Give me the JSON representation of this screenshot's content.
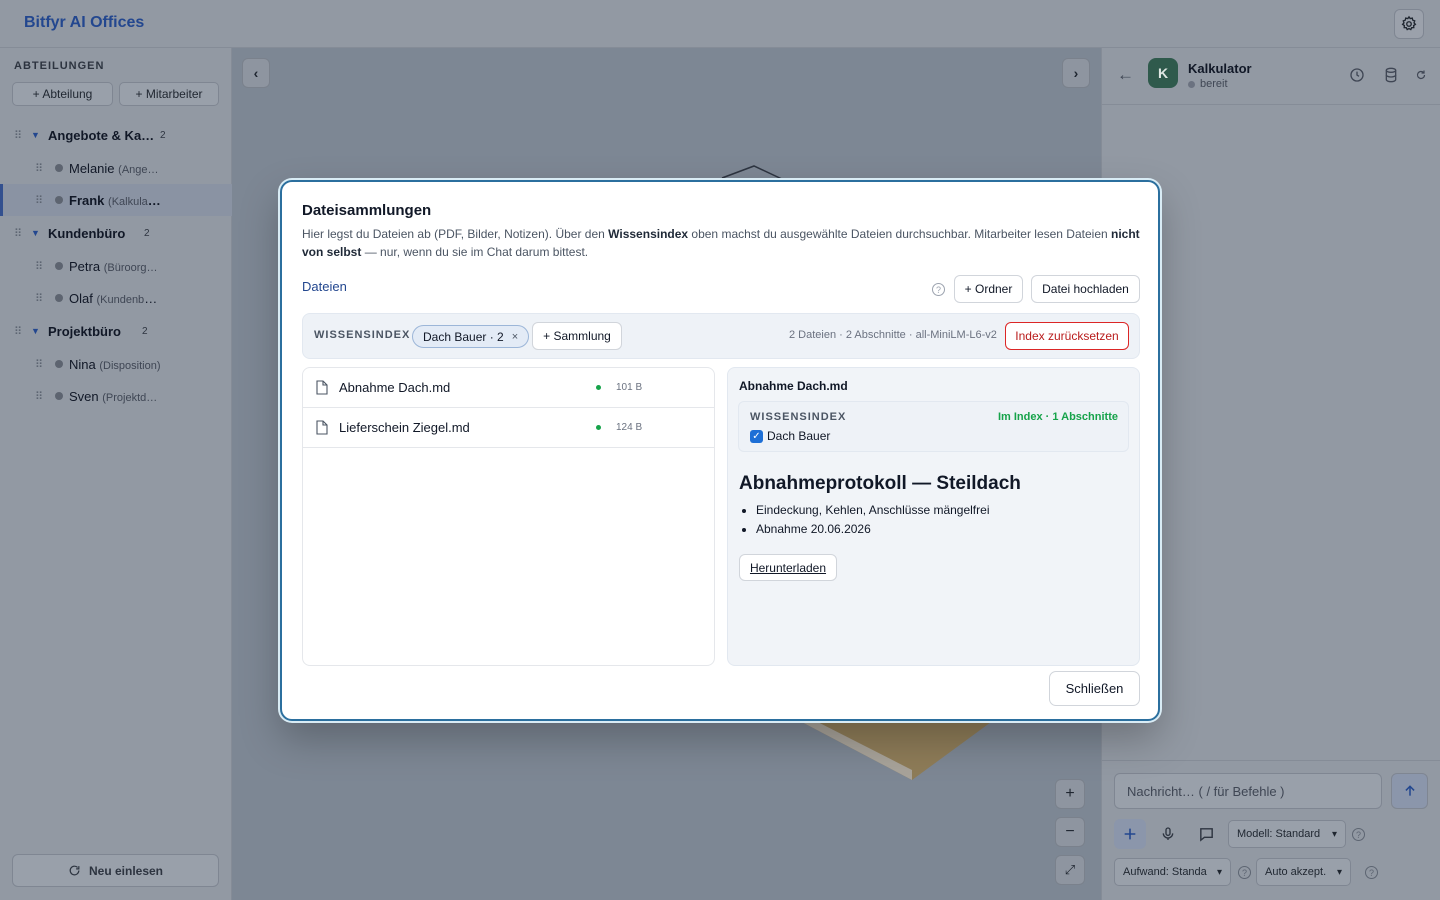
{
  "app": {
    "title": "Bitfyr AI Offices"
  },
  "sidebar": {
    "title": "ABTEILUNGEN",
    "add_department": "+ Abteilung",
    "add_employee": "+ Mitarbeiter",
    "departments": [
      {
        "name": "Angebote & Kal…",
        "count": "2",
        "employees": [
          {
            "name": "Melanie",
            "role": "(Ange…"
          },
          {
            "name": "Frank",
            "role": "(Kalkulat…"
          }
        ]
      },
      {
        "name": "Kundenbüro",
        "count": "2",
        "employees": [
          {
            "name": "Petra",
            "role": "(Büroorg…"
          },
          {
            "name": "Olaf",
            "role": "(Kundenbe…"
          }
        ]
      },
      {
        "name": "Projektbüro",
        "count": "2",
        "employees": [
          {
            "name": "Nina",
            "role": "(Disposition)"
          },
          {
            "name": "Sven",
            "role": "(Projektd…"
          }
        ]
      }
    ],
    "reload": "Neu einlesen"
  },
  "canvas": {
    "prev": "‹",
    "next": "›",
    "zoom_in": "+",
    "zoom_out": "−",
    "fit": "⤢"
  },
  "chat": {
    "back": "←",
    "avatar_letter": "K",
    "agent_name": "Kalkulator",
    "agent_status": "bereit",
    "input_placeholder": "Nachricht…  ( / für Befehle )",
    "model_select": "Modell: Standard",
    "effort_select": "Aufwand: Standa",
    "auto_select": "Auto akzept."
  },
  "modal": {
    "title": "Dateisammlungen",
    "desc_1": "Hier legst du Dateien ab (PDF, Bilder, Notizen). Über den ",
    "desc_2": "Wissensindex",
    "desc_3": " oben machst du ausgewählte Dateien durchsuchbar. Mitarbeiter lesen Dateien ",
    "desc_4": "nicht von selbst",
    "desc_5": " — nur, wenn du sie im Chat darum bittest.",
    "tab": "Dateien",
    "help": "?",
    "folder_btn": "+ Ordner",
    "upload_btn": "Datei hochladen",
    "index": {
      "label": "WISSENSINDEX",
      "chip": "Dach Bauer · 2",
      "chip_remove": "×",
      "add_collection": "+ Sammlung",
      "info": "2 Dateien · 2 Abschnitte · all-MiniLM-L6-v2",
      "reset": "Index zurücksetzen"
    },
    "files": [
      {
        "name": "Abnahme Dach.md",
        "size": "101 B"
      },
      {
        "name": "Lieferschein Ziegel.md",
        "size": "124 B"
      }
    ],
    "preview": {
      "file": "Abnahme Dach.md",
      "index_label": "WISSENSINDEX",
      "index_status": "Im Index · 1 Abschnitte",
      "collection": "Dach Bauer",
      "heading": "Abnahmeprotokoll — Steildach",
      "bullets": [
        "Eindeckung, Kehlen, Anschlüsse mängelfrei",
        "Abnahme 20.06.2026"
      ],
      "download": "Herunterladen"
    },
    "close": "Schließen"
  }
}
